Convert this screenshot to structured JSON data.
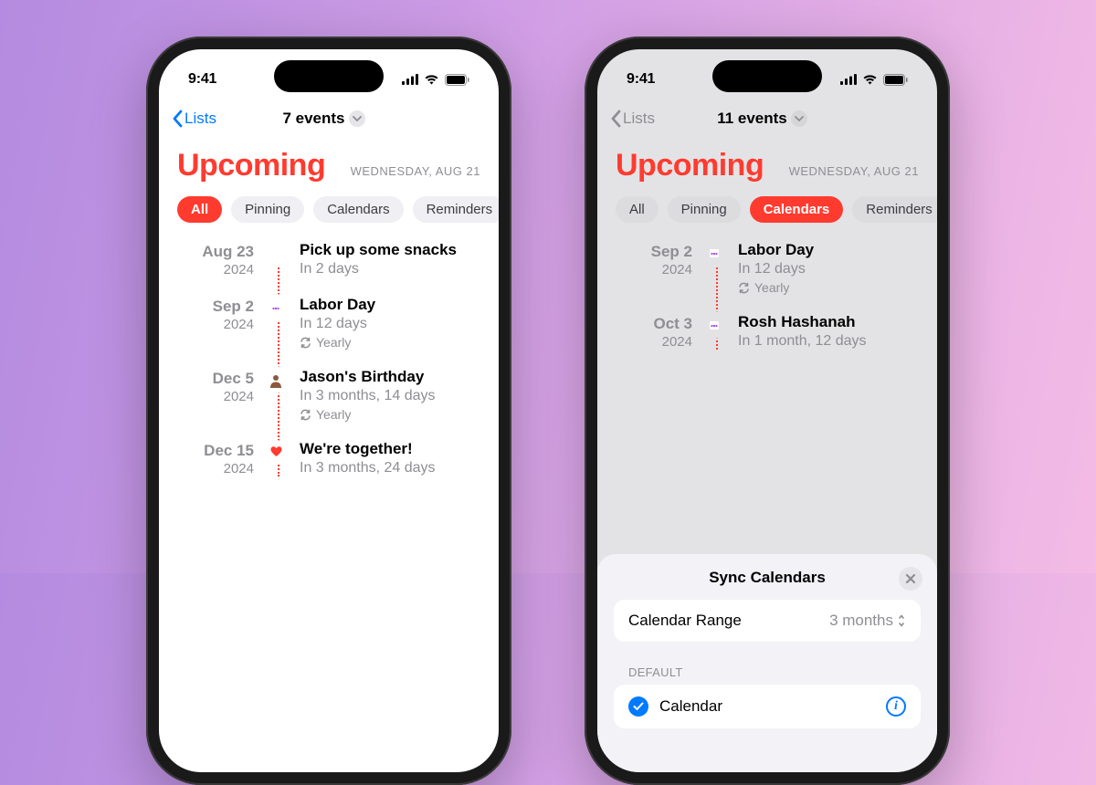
{
  "statusbar": {
    "time": "9:41"
  },
  "screens": [
    {
      "nav": {
        "back": "Lists",
        "title": "7 events"
      },
      "header": {
        "title": "Upcoming",
        "date": "WEDNESDAY, AUG 21"
      },
      "pills": [
        {
          "label": "All",
          "active": true
        },
        {
          "label": "Pinning",
          "active": false
        },
        {
          "label": "Calendars",
          "active": false
        },
        {
          "label": "Reminders",
          "active": false
        }
      ],
      "events": [
        {
          "md": "Aug 23",
          "year": "2024",
          "dot": "blue",
          "icon": "list",
          "title": "Pick up some snacks",
          "sub": "In 2 days",
          "recurring": null
        },
        {
          "md": "Sep 2",
          "year": "2024",
          "dot": "purple",
          "icon": "cal",
          "title": "Labor Day",
          "sub": "In 12 days",
          "recurring": "Yearly"
        },
        {
          "md": "Dec 5",
          "year": "2024",
          "dot": "orange",
          "icon": "face",
          "title": "Jason's Birthday",
          "sub": "In 3 months, 14 days",
          "recurring": "Yearly"
        },
        {
          "md": "Dec 15",
          "year": "2024",
          "dot": "red",
          "icon": "heart",
          "title": "We're together!",
          "sub": "In 3 months, 24 days",
          "recurring": null
        }
      ]
    },
    {
      "nav": {
        "back": "Lists",
        "title": "11 events"
      },
      "header": {
        "title": "Upcoming",
        "date": "WEDNESDAY, AUG 21"
      },
      "pills": [
        {
          "label": "All",
          "active": false
        },
        {
          "label": "Pinning",
          "active": false
        },
        {
          "label": "Calendars",
          "active": true
        },
        {
          "label": "Reminders",
          "active": false
        }
      ],
      "events": [
        {
          "md": "Sep 2",
          "year": "2024",
          "dot": "purple",
          "icon": "cal",
          "title": "Labor Day",
          "sub": "In 12 days",
          "recurring": "Yearly"
        },
        {
          "md": "Oct 3",
          "year": "2024",
          "dot": "purple",
          "icon": "cal",
          "title": "Rosh Hashanah",
          "sub": "In 1 month, 12 days",
          "recurring": null
        }
      ],
      "sheet": {
        "title": "Sync Calendars",
        "range": {
          "label": "Calendar Range",
          "value": "3 months"
        },
        "section": "DEFAULT",
        "calendar": {
          "name": "Calendar"
        }
      }
    }
  ]
}
